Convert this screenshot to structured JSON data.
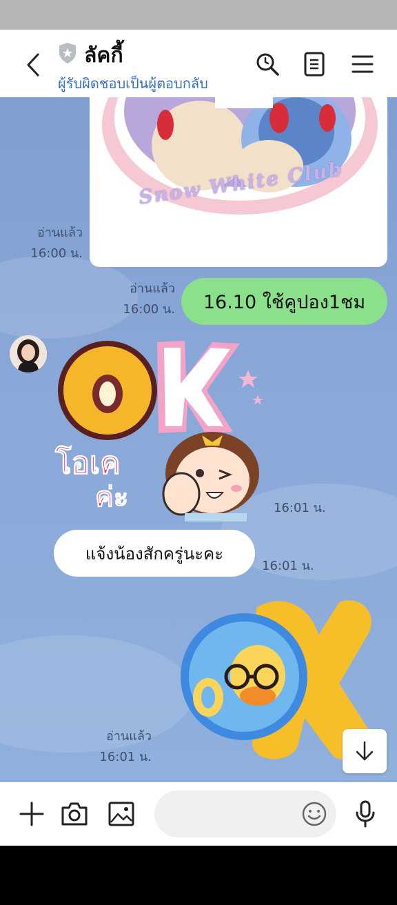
{
  "header": {
    "title": "ลัคกี้",
    "subtitle": "ผู้รับผิดชอบเป็นผู้ตอบกลับ",
    "icons": [
      "back-icon",
      "shield-icon",
      "search-icon",
      "notes-icon",
      "menu-icon"
    ]
  },
  "messages": [
    {
      "type": "image",
      "side": "outgoing",
      "image_text": "Snow White Club",
      "read_label": "อ่านแล้ว",
      "time": "16:00 น."
    },
    {
      "type": "text",
      "side": "outgoing",
      "text": "16.10 ใช้คูปอง1ชม",
      "read_label": "อ่านแล้ว",
      "time": "16:00 น."
    },
    {
      "type": "sticker",
      "side": "incoming",
      "sticker_text": "OK",
      "sticker_caption_1": "โอเค",
      "sticker_caption_2": "ค่ะ",
      "time": "16:01 น."
    },
    {
      "type": "text",
      "side": "incoming",
      "text": "แจ้งน้องสักครู่นะคะ",
      "time": "16:01 น."
    },
    {
      "type": "sticker",
      "side": "outgoing",
      "sticker_text": "OK",
      "read_label": "อ่านแล้ว",
      "time": "16:01 น."
    }
  ],
  "input": {
    "placeholder": "",
    "icons": [
      "plus-icon",
      "camera-icon",
      "gallery-icon",
      "emoji-icon",
      "microphone-icon"
    ]
  },
  "colors": {
    "chat_background": "#8aa8d8",
    "outgoing_bubble": "#8be08b",
    "incoming_bubble": "#ffffff",
    "subtitle": "#3a6fc4"
  }
}
